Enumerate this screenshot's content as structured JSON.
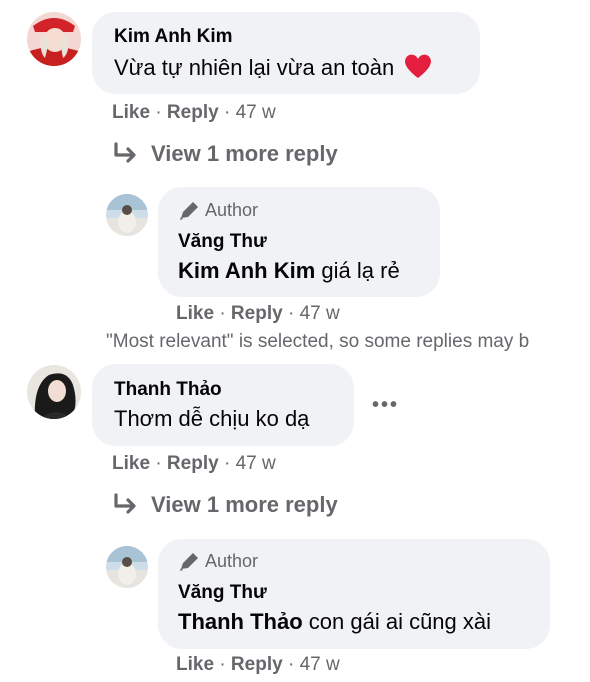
{
  "comments": [
    {
      "name": "Kim Anh Kim",
      "text": "Vừa tự nhiên lại vừa an toàn",
      "emoji": "❤️",
      "like": "Like",
      "reply": "Reply",
      "time": "47 w",
      "view_more": "View 1 more reply",
      "author_reply": {
        "badge": "Author",
        "name": "Văng Thư",
        "mention": "Kim Anh Kim",
        "text": "giá lạ rẻ",
        "like": "Like",
        "reply": "Reply",
        "time": "47 w"
      }
    },
    {
      "name": "Thanh Thảo",
      "text": "Thơm dễ chịu ko dạ",
      "more": "•••",
      "like": "Like",
      "reply": "Reply",
      "time": "47 w",
      "view_more": "View 1 more reply",
      "author_reply": {
        "badge": "Author",
        "name": "Văng Thư",
        "mention": "Thanh Thảo",
        "text": "con gái ai cũng xài",
        "like": "Like",
        "reply": "Reply",
        "time": "47 w"
      }
    }
  ],
  "notice": "\"Most relevant\" is selected, so some replies may b",
  "separator": "·",
  "icons": {
    "reply_arrow": "reply-arrow-icon",
    "pen": "pen-icon"
  },
  "colors": {
    "bubble": "#f0f2f5",
    "meta": "#65676b",
    "heart": "#e41e3f"
  }
}
